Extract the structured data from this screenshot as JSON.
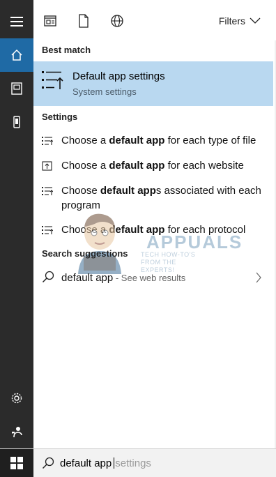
{
  "toolbar": {
    "filters_label": "Filters"
  },
  "best_match": {
    "heading": "Best match",
    "title": "Default app settings",
    "subtitle": "System settings"
  },
  "settings": {
    "heading": "Settings",
    "items": [
      {
        "pre": "Choose a ",
        "bold": "default app",
        "post": " for each type of file"
      },
      {
        "pre": "Choose a ",
        "bold": "default app",
        "post": " for each website"
      },
      {
        "pre": "Choose ",
        "bold": "default app",
        "post": "s associated with each program"
      },
      {
        "pre": "Choose a ",
        "bold": "default app",
        "post": " for each protocol"
      }
    ]
  },
  "suggestions": {
    "heading": "Search suggestions",
    "term": "default app",
    "separator": " - ",
    "hint": "See web results"
  },
  "search": {
    "typed": "default app",
    "completion": "settings"
  },
  "watermark": {
    "title": "APPUALS",
    "subtitle": "TECH HOW-TO'S FROM THE EXPERTS!"
  },
  "icons": {
    "rail": [
      "hamburger-icon",
      "home-icon",
      "document-icon",
      "phone-icon",
      "gear-icon",
      "feedback-icon"
    ],
    "toolbar": [
      "apps-icon",
      "documents-icon",
      "web-icon",
      "chevron-down-icon"
    ],
    "start": "windows-logo-icon"
  },
  "colors": {
    "rail_bg": "#2b2b2b",
    "rail_active": "#1f6aa5",
    "best_match_bg": "#b9d8f0",
    "taskbar_search_bg": "#f2f2f2"
  }
}
